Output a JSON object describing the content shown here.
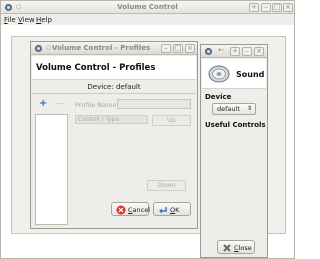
{
  "main_window": {
    "title": "Volume Control",
    "menu": [
      {
        "label": "File",
        "mnemonic": "F",
        "rest": "ile"
      },
      {
        "label": "View",
        "mnemonic": "V",
        "rest": "iew"
      },
      {
        "label": "Help",
        "mnemonic": "H",
        "rest": "elp"
      }
    ],
    "controls": {
      "minimize": "–",
      "maximize": "□",
      "close": "×",
      "menu": "+"
    }
  },
  "profiles_dialog": {
    "title": "Volume Control - Profiles",
    "header": "Volume Control - Profiles",
    "device_text": "Device: default",
    "add_icon": "+",
    "remove_icon": "—",
    "profile_name_label": "Profile Name:",
    "profile_name_value": "",
    "column_header": "Control / Type",
    "up_label": "Up",
    "down_label": "Down",
    "cancel_mnemonic": "C",
    "cancel_rest": "ancel",
    "ok_mnemonic": "O",
    "ok_rest": "K",
    "controls": {
      "minimize": "–",
      "maximize": "□",
      "close": "×"
    }
  },
  "sound_window": {
    "title_controls": {
      "back": "←",
      "menu": "+",
      "minimize": "–",
      "close": "×"
    },
    "header": "Sound",
    "device_label": "Device",
    "device_value": "default",
    "useful_controls_label": "Useful Controls",
    "close_mnemonic": "C",
    "close_rest": "lose"
  },
  "colors": {
    "accent_blue": "#2d6fc4",
    "cancel_red": "#d8332a",
    "ok_blue": "#3a78c8"
  }
}
